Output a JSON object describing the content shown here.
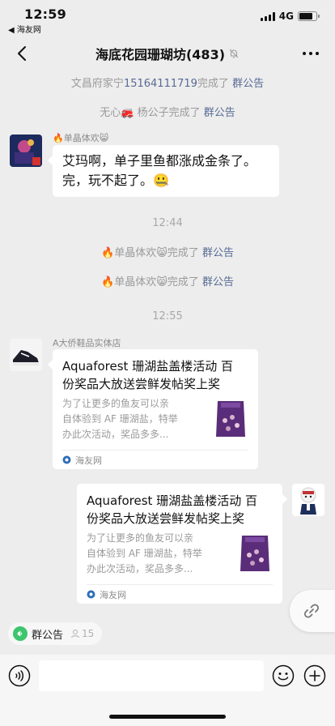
{
  "status_bar": {
    "time": "12:59",
    "back_app": "◀ 海友网",
    "network": "4G"
  },
  "nav": {
    "title": "海底花园珊瑚坊(483)",
    "back_icon": "chevron-left-icon",
    "mute_icon": "bell-off-icon",
    "more_icon": "more-dots-icon"
  },
  "system_msgs": [
    {
      "prefix": "文昌府家宁",
      "phone": "15164111719",
      "middle": "完成了 ",
      "link": "群公告"
    },
    {
      "prefix": "无心🚒 杨公子",
      "phone": "",
      "middle": "完成了 ",
      "link": "群公告"
    },
    {
      "prefix": "🔥单晶体欢😸",
      "phone": "",
      "middle": "完成了 ",
      "link": "群公告"
    },
    {
      "prefix": "🔥单晶体欢😸",
      "phone": "",
      "middle": "完成了 ",
      "link": "群公告"
    }
  ],
  "messages": [
    {
      "sender": "🔥单晶体欢😸",
      "text_line1": "艾玛啊，单子里鱼都涨成金条了。",
      "text_line2": "完，玩不起了。🤐"
    }
  ],
  "timestamps": [
    "12:44",
    "12:55"
  ],
  "cards": [
    {
      "sender": "A大侨鞋品实体店",
      "title_line1": "Aquaforest 珊湖盐盖楼活动 百",
      "title_line2": "份奖品大放送尝鲜发帖奖上奖",
      "desc_line1": "为了让更多的鱼友可以亲",
      "desc_line2": "自体验到 AF 珊湖盐，特举",
      "desc_line3": "办此次活动，奖品多多...",
      "source": "海友网"
    },
    {
      "sender": "",
      "title_line1": "Aquaforest 珊湖盐盖楼活动 百",
      "title_line2": "份奖品大放送尝鲜发帖奖上奖",
      "desc_line1": "为了让更多的鱼友可以亲",
      "desc_line2": "自体验到 AF 珊湖盐，特举",
      "desc_line3": "办此次活动，奖品多多...",
      "source": "海友网"
    }
  ],
  "share_icon": "link-icon",
  "notice_bar": {
    "label": "群公告",
    "count": "15"
  },
  "input_bar": {
    "voice_icon": "voice-icon",
    "placeholder": "",
    "emoji_icon": "emoji-icon",
    "plus_icon": "plus-circle-icon"
  },
  "colors": {
    "background": "#ededed",
    "link": "#576b95",
    "system_text": "#9a9a9a",
    "notice_green": "#3ec56f"
  }
}
